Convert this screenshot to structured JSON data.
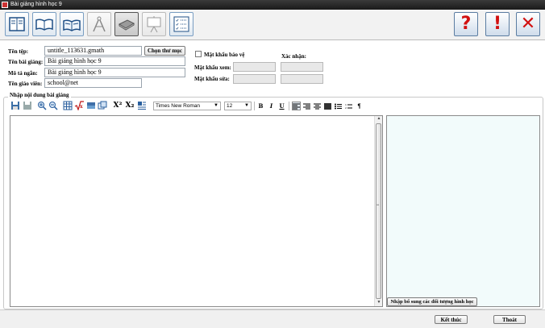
{
  "window": {
    "title": "Bài giảng hình học 9"
  },
  "toolbar": {
    "buttons": [
      {
        "icon": "notebook-icon"
      },
      {
        "icon": "open-book-icon"
      },
      {
        "icon": "open-book-alt-icon"
      },
      {
        "icon": "compass-icon"
      },
      {
        "icon": "book-closed-icon"
      },
      {
        "icon": "presentation-board-icon"
      },
      {
        "icon": "checklist-icon"
      }
    ],
    "right_buttons": [
      {
        "icon": "help-icon",
        "glyph": "?"
      },
      {
        "icon": "info-icon",
        "glyph": "!"
      },
      {
        "icon": "close-icon",
        "glyph": "✕"
      }
    ]
  },
  "form": {
    "file_label": "Tên tệp:",
    "file_value": "untitle_113631.gmath",
    "choose_folder_label": "Chọn thư mục",
    "lecture_name_label": "Tên bài giảng:",
    "lecture_name_value": "Bài giảng hình học 9",
    "description_label": "Mô tả ngắn:",
    "description_value": "Bài giảng hình học 9",
    "teacher_label": "Tên giáo viên:",
    "teacher_value": "school@net",
    "protect_label": "Mật khẩu bảo vệ",
    "confirm_label": "Xác nhận:",
    "view_password_label": "Mật khẩu xem:",
    "edit_password_label": "Mật khẩu sửa:"
  },
  "content": {
    "group_title": "Nhập nội dung bài giảng",
    "font_name": "Times New Roman",
    "font_size": "12",
    "superscript_label": "X²",
    "subscript_label": "X₂",
    "bold_label": "B",
    "italic_label": "I",
    "underline_label": "U",
    "paragraph_label": "¶",
    "objects_button_label": "Nhập bổ sung các đối tượng hình học"
  },
  "footer": {
    "finish_label": "Kết thúc",
    "exit_label": "Thoát"
  }
}
